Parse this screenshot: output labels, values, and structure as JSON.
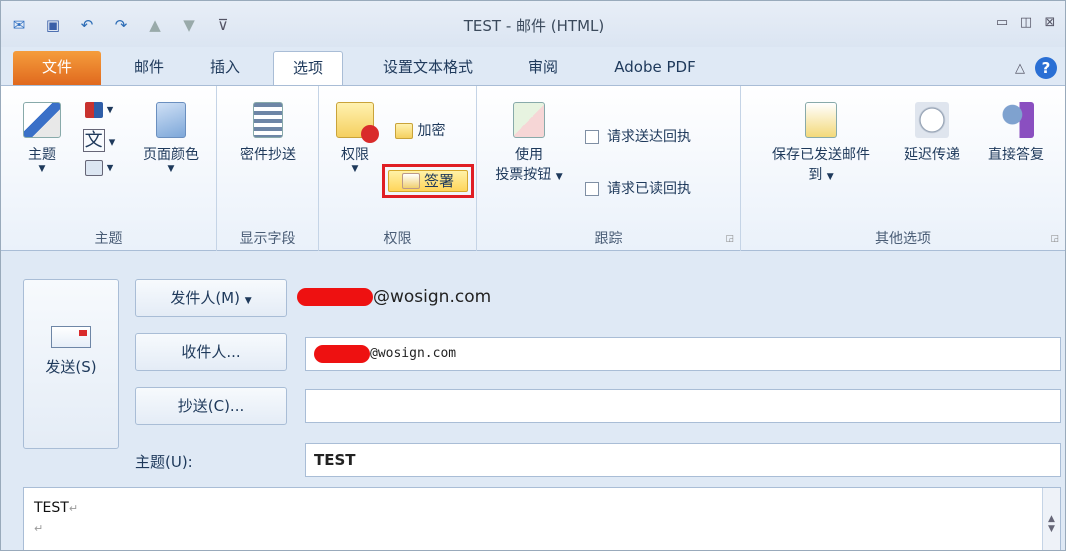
{
  "window": {
    "title": "TEST - 邮件 (HTML)",
    "controls": [
      "minimize-icon",
      "restore-icon",
      "close-icon"
    ]
  },
  "quick_access": [
    "app-icon",
    "save-icon",
    "undo-icon",
    "redo-icon",
    "up-icon",
    "down-icon",
    "customize-icon"
  ],
  "tabs": [
    {
      "label": "文件"
    },
    {
      "label": "邮件"
    },
    {
      "label": "插入"
    },
    {
      "label": "选项"
    },
    {
      "label": "设置文本格式"
    },
    {
      "label": "审阅"
    },
    {
      "label": "Adobe PDF"
    }
  ],
  "ribbon": {
    "theme_group": {
      "label": "主题",
      "theme_btn": "主题",
      "page_color_btn": "页面颜色"
    },
    "show_fields_group": {
      "label": "显示字段",
      "bcc_btn": "密件抄送"
    },
    "permission_group": {
      "label": "权限",
      "permission_btn": "权限",
      "encrypt_btn": "加密",
      "sign_btn": "签署"
    },
    "tracking_group": {
      "label": "跟踪",
      "vote_btn_line1": "使用",
      "vote_btn_line2": "投票按钮",
      "delivery_receipt": "请求送达回执",
      "read_receipt": "请求已读回执"
    },
    "more_options_group": {
      "label": "其他选项",
      "save_sent_line1": "保存已发送邮件",
      "save_sent_line2": "到",
      "delay_delivery": "延迟传递",
      "direct_replies": "直接答复"
    }
  },
  "compose": {
    "send_label": "发送(S)",
    "from_btn": "发件人(M)",
    "from_value": "@wosign.com",
    "to_btn": "收件人...",
    "to_value": "@wosign.com",
    "cc_btn": "抄送(C)...",
    "cc_value": "",
    "subject_label": "主题(U):",
    "subject_value": "TEST",
    "body_text": "TEST"
  },
  "colors": {
    "file_tab": "#e0691e",
    "highlight_border": "#e01e24",
    "redaction": "#ee1111"
  }
}
